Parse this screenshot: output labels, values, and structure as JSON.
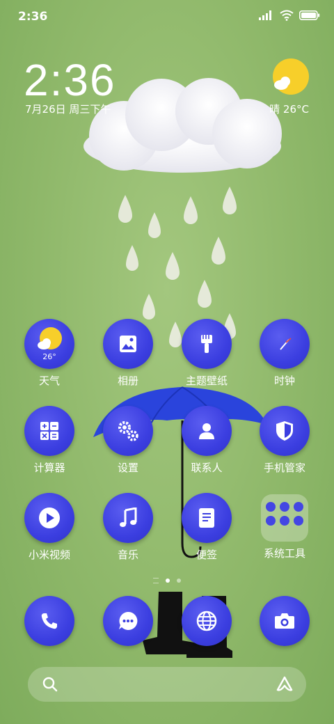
{
  "status_bar": {
    "time": "2:36"
  },
  "clock_widget": {
    "time": "2:36",
    "date": "7月26日 周三下午"
  },
  "weather_widget": {
    "summary": "晴 26°C"
  },
  "apps": [
    {
      "id": "weather",
      "label": "天气",
      "icon": "weather-icon",
      "badge": "26°"
    },
    {
      "id": "gallery",
      "label": "相册",
      "icon": "gallery-icon"
    },
    {
      "id": "themes",
      "label": "主题壁纸",
      "icon": "brush-icon"
    },
    {
      "id": "clock",
      "label": "时钟",
      "icon": "clock-icon"
    },
    {
      "id": "calculator",
      "label": "计算器",
      "icon": "calculator-icon"
    },
    {
      "id": "settings",
      "label": "设置",
      "icon": "gear-icon"
    },
    {
      "id": "contacts",
      "label": "联系人",
      "icon": "person-icon"
    },
    {
      "id": "security",
      "label": "手机管家",
      "icon": "shield-icon"
    },
    {
      "id": "video",
      "label": "小米视频",
      "icon": "play-icon"
    },
    {
      "id": "music",
      "label": "音乐",
      "icon": "music-note-icon"
    },
    {
      "id": "notes",
      "label": "便签",
      "icon": "note-icon"
    },
    {
      "id": "tools",
      "label": "系统工具",
      "icon": "folder-icon"
    }
  ],
  "page_indicator": {
    "pages": 3,
    "active": 2
  },
  "dock": [
    {
      "id": "phone",
      "icon": "phone-icon"
    },
    {
      "id": "messages",
      "icon": "message-icon"
    },
    {
      "id": "browser",
      "icon": "globe-icon"
    },
    {
      "id": "camera",
      "icon": "camera-icon"
    }
  ],
  "colors": {
    "background": "#8fb86a",
    "icon_fill": "#3b3ee0",
    "sun": "#f7cf2a",
    "umbrella": "#2740d8"
  }
}
